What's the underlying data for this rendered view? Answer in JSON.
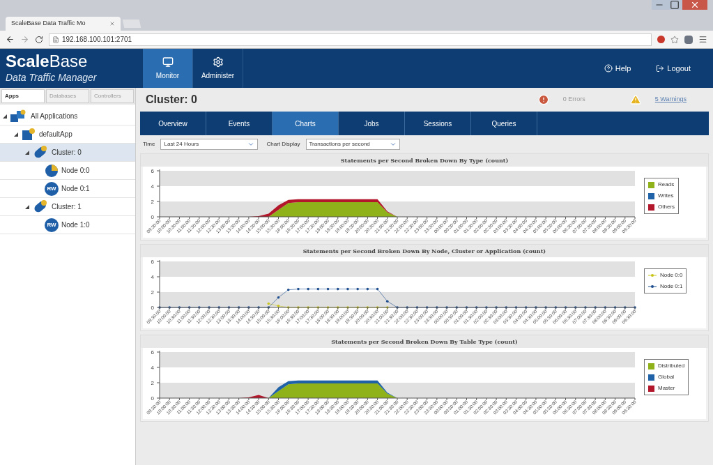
{
  "browser": {
    "tab_title": "ScaleBase Data Traffic Mo",
    "url": "192.168.100.101:2701"
  },
  "header": {
    "logo": "**Scale**Base",
    "subtitle": "Data Traffic Manager",
    "nav": [
      {
        "label": "Monitor",
        "selected": true
      },
      {
        "label": "Administer",
        "selected": false
      }
    ],
    "help": "Help",
    "logout": "Logout"
  },
  "sidebar": {
    "tabs": [
      {
        "label": "Apps",
        "selected": true
      },
      {
        "label": "Databases",
        "selected": false
      },
      {
        "label": "Controllers",
        "selected": false
      }
    ],
    "tree": [
      {
        "label": "All Applications",
        "kind": "apps",
        "expanded": true,
        "selected": false,
        "children": [
          {
            "label": "defaultApp",
            "kind": "app",
            "expanded": true,
            "selected": false,
            "children": [
              {
                "label": "Cluster: 0",
                "kind": "cluster",
                "expanded": true,
                "selected": true,
                "children": [
                  {
                    "label": "Node 0:0",
                    "kind": "node",
                    "selected": false
                  },
                  {
                    "label": "Node 0:1",
                    "kind": "node",
                    "badge": "RW",
                    "selected": false
                  }
                ]
              },
              {
                "label": "Cluster: 1",
                "kind": "cluster",
                "expanded": true,
                "selected": false,
                "children": [
                  {
                    "label": "Node 1:0",
                    "kind": "node",
                    "badge": "RW",
                    "selected": false
                  }
                ]
              }
            ]
          }
        ]
      }
    ]
  },
  "main": {
    "title": "Cluster: 0",
    "errors": "0 Errors",
    "warnings": "5 Warnings",
    "tabs": [
      {
        "label": "Overview",
        "selected": false
      },
      {
        "label": "Events",
        "selected": false
      },
      {
        "label": "Charts",
        "selected": true
      },
      {
        "label": "Jobs",
        "selected": false
      },
      {
        "label": "Sessions",
        "selected": false
      },
      {
        "label": "Queries",
        "selected": false
      }
    ],
    "time_label": "Time",
    "time_value": "Last 24 Hours",
    "display_label": "Chart Display",
    "display_value": "Transactions per second",
    "charts": [
      {
        "chart_data": {
          "type": "area",
          "stacked": true,
          "title": "Statements per Second Broken Down By Type (count)",
          "ylim": [
            0,
            6
          ],
          "yticks": [
            0,
            2,
            4,
            6
          ],
          "categories": [
            "09:30:00",
            "10:00:00",
            "10:30:00",
            "11:00:00",
            "11:30:00",
            "12:00:00",
            "12:30:00",
            "13:00:00",
            "13:30:00",
            "14:00:00",
            "14:30:00",
            "15:00:00",
            "15:30:00",
            "16:00:00",
            "16:30:00",
            "17:00:00",
            "17:30:00",
            "18:00:00",
            "18:30:00",
            "19:00:00",
            "19:30:00",
            "20:00:00",
            "20:30:00",
            "21:00:00",
            "21:30:00",
            "22:00:00",
            "22:30:00",
            "23:00:00",
            "23:30:00",
            "00:00:00",
            "00:30:00",
            "01:00:00",
            "01:30:00",
            "02:00:00",
            "02:30:00",
            "03:00:00",
            "03:30:00",
            "04:00:00",
            "04:30:00",
            "05:00:00",
            "05:30:00",
            "06:00:00",
            "06:30:00",
            "07:00:00",
            "07:30:00",
            "08:00:00",
            "08:30:00",
            "09:00:00",
            "09:30:00"
          ],
          "series": [
            {
              "name": "Reads",
              "color": "#8fb21a",
              "values": [
                null,
                null,
                null,
                null,
                null,
                null,
                null,
                null,
                null,
                null,
                null,
                0,
                0.9,
                1.8,
                1.9,
                1.9,
                1.9,
                1.9,
                1.9,
                1.9,
                1.9,
                1.9,
                1.9,
                0.6,
                0,
                null,
                null,
                null,
                null,
                null,
                null,
                null,
                null,
                null,
                null,
                null,
                null,
                null,
                null,
                null,
                null,
                null,
                null,
                null,
                null,
                null,
                null,
                null,
                null
              ]
            },
            {
              "name": "Writes",
              "color": "#1f62a8",
              "values": [
                null,
                null,
                null,
                null,
                null,
                null,
                null,
                null,
                null,
                null,
                null,
                null,
                null,
                null,
                null,
                null,
                null,
                null,
                null,
                null,
                null,
                null,
                null,
                null,
                null,
                null,
                null,
                null,
                null,
                null,
                null,
                null,
                null,
                null,
                null,
                null,
                null,
                null,
                null,
                null,
                null,
                null,
                null,
                null,
                null,
                null,
                null,
                null,
                null
              ]
            },
            {
              "name": "Others",
              "color": "#b3172b",
              "values": [
                null,
                null,
                null,
                null,
                null,
                null,
                null,
                null,
                null,
                0,
                0.1,
                0.4,
                0.6,
                0.4,
                0.4,
                0.4,
                0.4,
                0.4,
                0.4,
                0.4,
                0.4,
                0.4,
                0.4,
                0.1,
                0,
                null,
                null,
                null,
                null,
                null,
                null,
                null,
                null,
                null,
                null,
                null,
                null,
                null,
                null,
                null,
                null,
                null,
                null,
                null,
                null,
                null,
                null,
                null,
                null
              ]
            }
          ]
        }
      },
      {
        "chart_data": {
          "type": "line",
          "title": "Statements per Second Broken Down By Node, Cluster or Application (count)",
          "ylim": [
            0,
            6
          ],
          "yticks": [
            0,
            2,
            4,
            6
          ],
          "categories": [
            "09:30:00",
            "10:00:00",
            "10:30:00",
            "11:00:00",
            "11:30:00",
            "12:00:00",
            "12:30:00",
            "13:00:00",
            "13:30:00",
            "14:00:00",
            "14:30:00",
            "15:00:00",
            "15:30:00",
            "16:00:00",
            "16:30:00",
            "17:00:00",
            "17:30:00",
            "18:00:00",
            "18:30:00",
            "19:00:00",
            "19:30:00",
            "20:00:00",
            "20:30:00",
            "21:00:00",
            "21:30:00",
            "22:00:00",
            "22:30:00",
            "23:00:00",
            "23:30:00",
            "00:00:00",
            "00:30:00",
            "01:00:00",
            "01:30:00",
            "02:00:00",
            "02:30:00",
            "03:00:00",
            "03:30:00",
            "04:00:00",
            "04:30:00",
            "05:00:00",
            "05:30:00",
            "06:00:00",
            "06:30:00",
            "07:00:00",
            "07:30:00",
            "08:00:00",
            "08:30:00",
            "09:00:00",
            "09:30:00"
          ],
          "series": [
            {
              "name": "Node 0:0",
              "color": "#c9c41c",
              "values": [
                null,
                null,
                null,
                null,
                null,
                null,
                null,
                null,
                null,
                null,
                null,
                0.5,
                0.2,
                0,
                0,
                0,
                0,
                0,
                0,
                0,
                0,
                0,
                0,
                0,
                null,
                null,
                null,
                null,
                null,
                null,
                null,
                null,
                null,
                null,
                null,
                null,
                null,
                null,
                null,
                null,
                null,
                null,
                null,
                null,
                null,
                null,
                null,
                null,
                null
              ]
            },
            {
              "name": "Node 0:1",
              "color": "#1f4f8f",
              "values": [
                0,
                0,
                0,
                0,
                0,
                0,
                0,
                0,
                0,
                0,
                0,
                0,
                1.3,
                2.3,
                2.4,
                2.4,
                2.4,
                2.4,
                2.4,
                2.4,
                2.4,
                2.4,
                2.4,
                0.8,
                0,
                0,
                0,
                0,
                0,
                0,
                0,
                0,
                0,
                0,
                0,
                0,
                0,
                0,
                0,
                0,
                0,
                0,
                0,
                0,
                0,
                0,
                0,
                0,
                0
              ]
            }
          ]
        }
      },
      {
        "chart_data": {
          "type": "area",
          "stacked": true,
          "title": "Statements per Second Broken Down By Table Type (count)",
          "ylim": [
            0,
            6
          ],
          "yticks": [
            0,
            2,
            4,
            6
          ],
          "categories": [
            "09:30:00",
            "10:00:00",
            "10:30:00",
            "11:00:00",
            "11:30:00",
            "12:00:00",
            "12:30:00",
            "13:00:00",
            "13:30:00",
            "14:00:00",
            "14:30:00",
            "15:00:00",
            "15:30:00",
            "16:00:00",
            "16:30:00",
            "17:00:00",
            "17:30:00",
            "18:00:00",
            "18:30:00",
            "19:00:00",
            "19:30:00",
            "20:00:00",
            "20:30:00",
            "21:00:00",
            "21:30:00",
            "22:00:00",
            "22:30:00",
            "23:00:00",
            "23:30:00",
            "00:00:00",
            "00:30:00",
            "01:00:00",
            "01:30:00",
            "02:00:00",
            "02:30:00",
            "03:00:00",
            "03:30:00",
            "04:00:00",
            "04:30:00",
            "05:00:00",
            "05:30:00",
            "06:00:00",
            "06:30:00",
            "07:00:00",
            "07:30:00",
            "08:00:00",
            "08:30:00",
            "09:00:00",
            "09:30:00"
          ],
          "series": [
            {
              "name": "Distributed",
              "color": "#8fb21a",
              "values": [
                null,
                null,
                null,
                null,
                null,
                null,
                null,
                null,
                null,
                null,
                null,
                0,
                0.9,
                1.8,
                1.9,
                1.9,
                1.9,
                1.9,
                1.9,
                1.9,
                1.9,
                1.9,
                1.9,
                0.6,
                0,
                null,
                null,
                null,
                null,
                null,
                null,
                null,
                null,
                null,
                null,
                null,
                null,
                null,
                null,
                null,
                null,
                null,
                null,
                null,
                null,
                null,
                null,
                null,
                null
              ]
            },
            {
              "name": "Global",
              "color": "#1f62a8",
              "values": [
                null,
                null,
                null,
                null,
                null,
                null,
                null,
                null,
                null,
                null,
                null,
                0,
                0.5,
                0.4,
                0.4,
                0.4,
                0.4,
                0.4,
                0.4,
                0.4,
                0.4,
                0.4,
                0.4,
                0.1,
                0,
                null,
                null,
                null,
                null,
                null,
                null,
                null,
                null,
                null,
                null,
                null,
                null,
                null,
                null,
                null,
                null,
                null,
                null,
                null,
                null,
                null,
                null,
                null,
                null
              ]
            },
            {
              "name": "Master",
              "color": "#b3172b",
              "values": [
                null,
                null,
                null,
                null,
                null,
                null,
                null,
                null,
                0,
                0.1,
                0.4,
                0,
                null,
                null,
                null,
                null,
                null,
                null,
                null,
                null,
                null,
                null,
                null,
                null,
                null,
                null,
                null,
                null,
                null,
                null,
                null,
                null,
                null,
                null,
                null,
                null,
                null,
                null,
                null,
                null,
                null,
                null,
                null,
                null,
                null,
                null,
                null,
                null,
                null
              ]
            }
          ]
        }
      }
    ]
  }
}
